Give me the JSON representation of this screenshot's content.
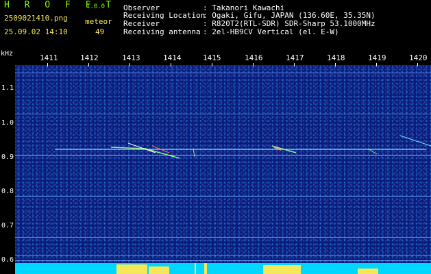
{
  "app": {
    "brand": "H R O F F T",
    "version": "1.0.0"
  },
  "file": {
    "name": "2509021410.png",
    "datetime": "25.09.02 14:10"
  },
  "detection": {
    "label": "meteor",
    "count": "49"
  },
  "info": {
    "observer_label": "Observer",
    "observer_value": ": Takanori Kawachi",
    "location_label": "Receiving Location",
    "location_value": ": Ogaki, Gifu, JAPAN (136.60E, 35.35N)",
    "receiver_label": "Receiver",
    "receiver_value": ": R820T2(RTL-SDR) SDR-Sharp 53.1000MHz",
    "antenna_label": "Receiving antenna",
    "antenna_value": ": 2el-HB9CV Vertical (el. E-W)"
  },
  "axis": {
    "unit": "kHz",
    "y_labels": [
      "1.1",
      "1.0",
      "0.9",
      "0.8",
      "0.7",
      "0.6"
    ],
    "x_labels": [
      "1411",
      "1412",
      "1413",
      "1414",
      "1415",
      "1416",
      "1417",
      "1418",
      "1419",
      "1420"
    ]
  },
  "colors": {
    "background": "#0b1d7a",
    "header_green": "#7CFC00",
    "header_yellow": "#f4e75a",
    "bars_cyan": "#00d7ff"
  }
}
